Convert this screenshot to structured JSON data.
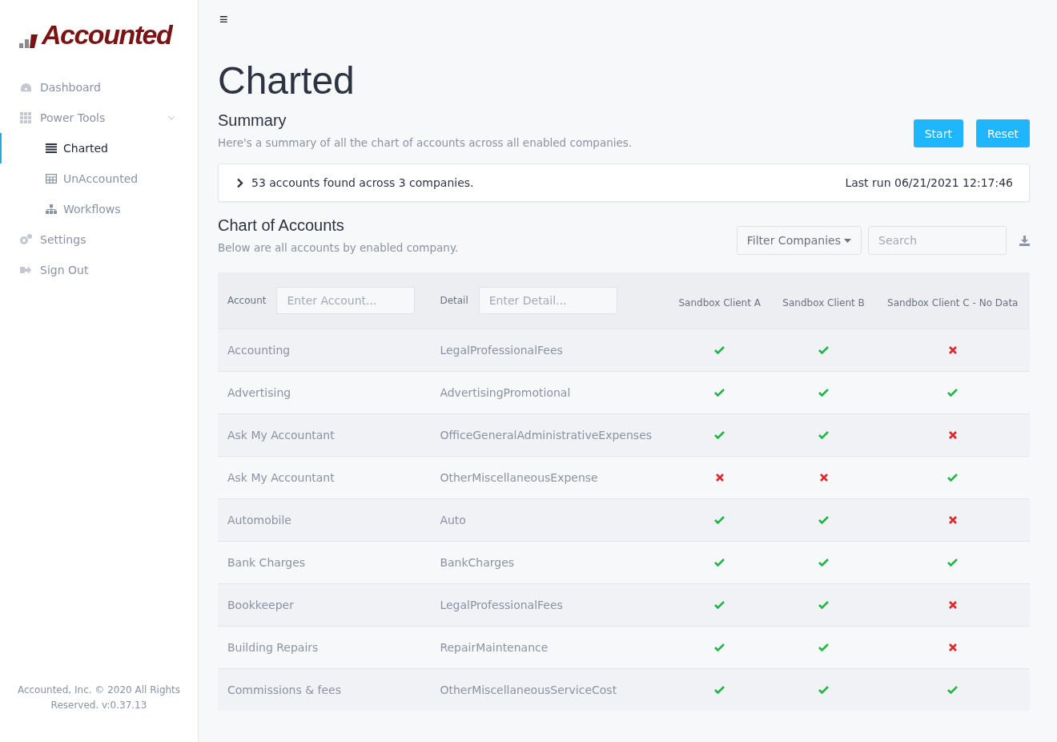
{
  "logo": {
    "text": "Accounted"
  },
  "menu_button": "≡",
  "sidebar": {
    "items": [
      {
        "label": "Dashboard",
        "selected": false
      },
      {
        "label": "Power Tools",
        "selected": false,
        "expanded": true,
        "children": [
          {
            "label": "Charted",
            "selected": true
          },
          {
            "label": "UnAccounted",
            "selected": false
          },
          {
            "label": "Workflows",
            "selected": false
          }
        ]
      },
      {
        "label": "Settings",
        "selected": false
      },
      {
        "label": "Sign Out",
        "selected": false
      }
    ],
    "footer": "Accounted, Inc. © 2020 All Rights Reserved. v:0.37.13"
  },
  "page_title": "Charted",
  "summary": {
    "title": "Summary",
    "description": "Here's a summary of all the chart of accounts across all enabled companies.",
    "buttons": [
      "Start",
      "Reset"
    ],
    "result": "53 accounts found across 3 companies.",
    "last_run": "Last run 06/21/2021 12:17:46",
    "expanded": false
  },
  "chart_of_accounts": {
    "title": "Chart of Accounts",
    "description": "Below are all accounts by enabled company.",
    "filter_button": "Filter Companies",
    "search": {
      "placeholder": "Search"
    }
  },
  "table": {
    "account_column": {
      "label": "Account",
      "placeholder": "Enter Account..."
    },
    "detail_column": {
      "label": "Detail",
      "placeholder": "Enter Detail..."
    },
    "companies": [
      "Sandbox Client A",
      "Sandbox Client B",
      "Sandbox Client C - No Data"
    ],
    "rows": [
      {
        "account": "Accounting",
        "detail": "LegalProfessionalFees",
        "present": [
          true,
          true,
          false
        ]
      },
      {
        "account": "Advertising",
        "detail": "AdvertisingPromotional",
        "present": [
          true,
          true,
          true
        ]
      },
      {
        "account": "Ask My Accountant",
        "detail": "OfficeGeneralAdministrativeExpenses",
        "present": [
          true,
          true,
          false
        ]
      },
      {
        "account": "Ask My Accountant",
        "detail": "OtherMiscellaneousExpense",
        "present": [
          false,
          false,
          true
        ]
      },
      {
        "account": "Automobile",
        "detail": "Auto",
        "present": [
          true,
          true,
          false
        ]
      },
      {
        "account": "Bank Charges",
        "detail": "BankCharges",
        "present": [
          true,
          true,
          true
        ]
      },
      {
        "account": "Bookkeeper",
        "detail": "LegalProfessionalFees",
        "present": [
          true,
          true,
          false
        ]
      },
      {
        "account": "Building Repairs",
        "detail": "RepairMaintenance",
        "present": [
          true,
          true,
          false
        ]
      },
      {
        "account": "Commissions & fees",
        "detail": "OtherMiscellaneousServiceCost",
        "present": [
          true,
          true,
          true
        ]
      }
    ]
  }
}
